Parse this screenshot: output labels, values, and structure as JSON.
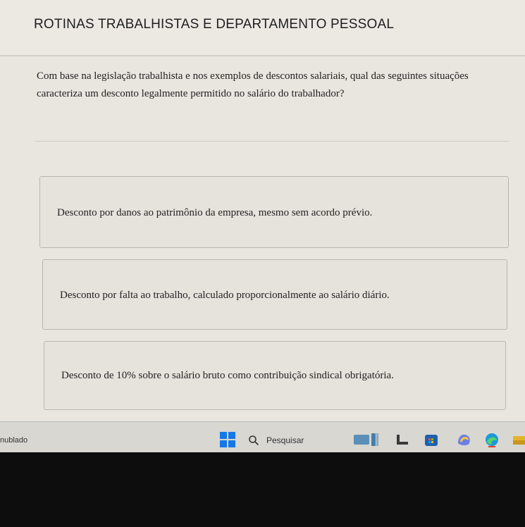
{
  "header": {
    "title": "ROTINAS TRABALHISTAS E DEPARTAMENTO PESSOAL"
  },
  "question": {
    "text": "Com base na legislação trabalhista e nos exemplos de descontos salariais, qual das seguintes situações caracteriza um desconto legalmente permitido no salário do trabalhador?"
  },
  "options": [
    {
      "label": "Desconto por danos ao patrimônio da empresa, mesmo sem acordo prévio."
    },
    {
      "label": "Desconto por falta ao trabalho, calculado proporcionalmente ao salário diário."
    },
    {
      "label": "Desconto de 10% sobre o salário bruto como contribuição sindical obrigatória."
    }
  ],
  "taskbar": {
    "weather": "nublado",
    "search_label": "Pesquisar",
    "icons": [
      "windows-start-icon",
      "search-icon",
      "widgets-icon",
      "file-explorer-icon",
      "store-icon",
      "copilot-icon",
      "edge-icon",
      "folder-icon"
    ],
    "colors": {
      "start": "#1677e8",
      "taskbar": "#d8d7d2"
    }
  }
}
